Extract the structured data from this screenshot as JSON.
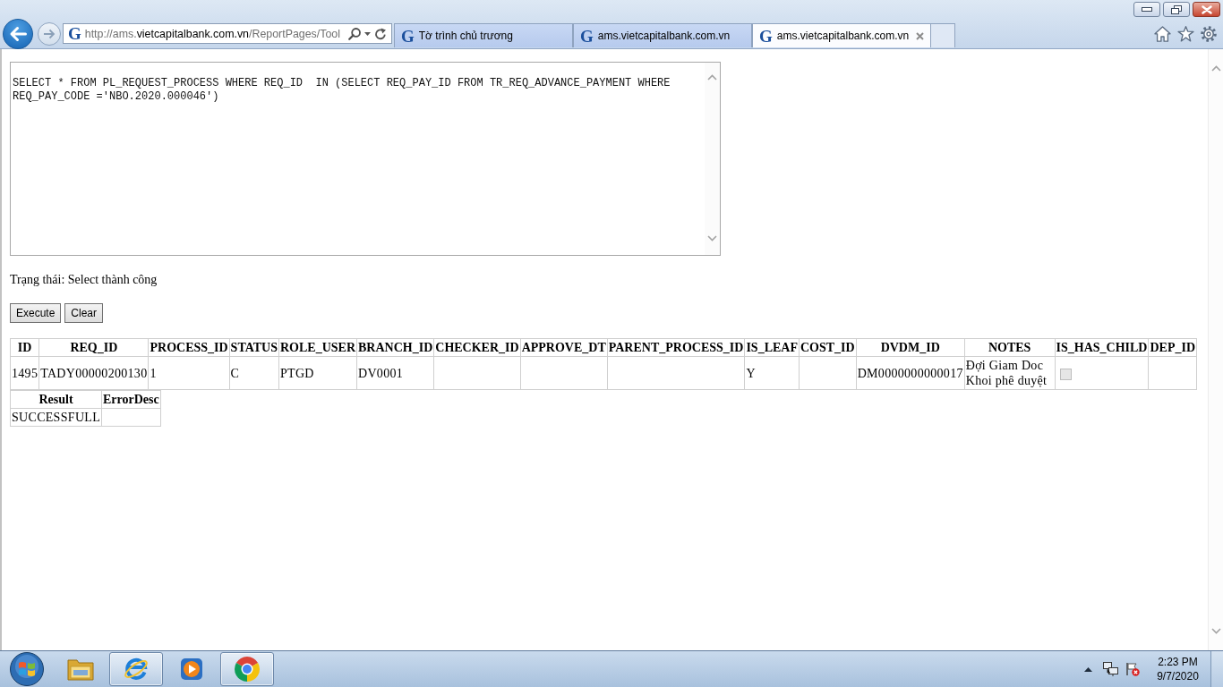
{
  "address_bar": {
    "favicon": "G",
    "url": [
      {
        "text": "http://ams.",
        "highlighted": false
      },
      {
        "text": "vietcapitalbank.com.vn",
        "highlighted": true
      },
      {
        "text": "/ReportPages/Tool",
        "highlighted": false
      }
    ]
  },
  "tabs": [
    {
      "favicon": "G",
      "title": "Tờ trình chủ trương",
      "selected": false
    },
    {
      "favicon": "G",
      "title": "ams.vietcapitalbank.com.vn",
      "selected": false
    },
    {
      "favicon": "G",
      "title": "ams.vietcapitalbank.com.vn",
      "selected": true
    }
  ],
  "page": {
    "query": {
      "value": "SELECT * FROM PL_REQUEST_PROCESS WHERE REQ_ID  IN (SELECT REQ_PAY_ID FROM TR_REQ_ADVANCE_PAYMENT WHERE REQ_PAY_CODE ='NBO.2020.000046')"
    },
    "status_text": "Trạng thái: Select thành công",
    "buttons": [
      {
        "label": "Execute"
      },
      {
        "label": "Clear"
      }
    ],
    "result_table": {
      "columns": [
        "ID",
        "REQ_ID",
        "PROCESS_ID",
        "STATUS",
        "ROLE_USER",
        "BRANCH_ID",
        "CHECKER_ID",
        "APPROVE_DT",
        "PARENT_PROCESS_ID",
        "IS_LEAF",
        "COST_ID",
        "DVDM_ID",
        "NOTES",
        "IS_HAS_CHILD",
        "DEP_ID"
      ],
      "rows": [
        {
          "cells": [
            {
              "kind": "text",
              "text": "1495"
            },
            {
              "kind": "text",
              "text": "TADY00000200130"
            },
            {
              "kind": "text",
              "text": "1"
            },
            {
              "kind": "text",
              "text": "C"
            },
            {
              "kind": "text",
              "text": "PTGD"
            },
            {
              "kind": "text",
              "text": "DV0001"
            },
            {
              "kind": "blank"
            },
            {
              "kind": "blank"
            },
            {
              "kind": "blank"
            },
            {
              "kind": "text",
              "text": "Y"
            },
            {
              "kind": "blank"
            },
            {
              "kind": "text",
              "text": "DM0000000000017"
            },
            {
              "kind": "text",
              "text": "Đợi Giam Doc Khoi phê duyệt"
            },
            {
              "kind": "checkbox",
              "checked": false,
              "disabled": true
            },
            {
              "kind": "blank"
            }
          ]
        }
      ]
    },
    "summary_table": {
      "columns": [
        "Result",
        "ErrorDesc"
      ],
      "rows": [
        {
          "cells": [
            {
              "kind": "text",
              "text": "SUCCESSFULL"
            },
            {
              "kind": "blank"
            }
          ]
        }
      ]
    }
  },
  "taskbar": {
    "apps": [
      {
        "kind": "folder",
        "running": false
      },
      {
        "kind": "ie",
        "running": true
      },
      {
        "kind": "player",
        "running": false
      },
      {
        "kind": "chrome",
        "running": true
      }
    ],
    "clock": {
      "time": "2:23 PM",
      "date": "9/7/2020"
    }
  }
}
